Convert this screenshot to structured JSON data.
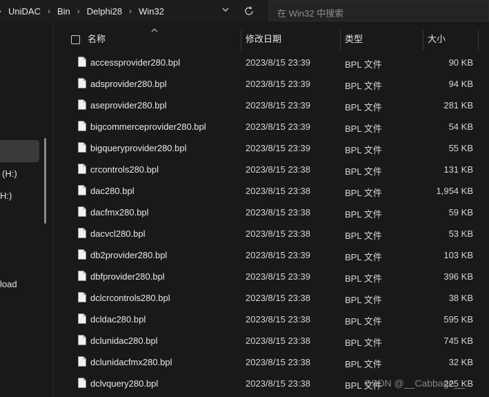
{
  "address_bar": {
    "breadcrumbs": [
      "UniDAC",
      "Bin",
      "Delphi28",
      "Win32"
    ],
    "separator": "›",
    "dropdown_icon": "chevron-down-icon",
    "refresh_icon": "refresh-icon"
  },
  "search": {
    "placeholder": "在 Win32 中搜索"
  },
  "sidebar": {
    "fragments": [
      "(H:)",
      "H:)",
      "load"
    ]
  },
  "columns": {
    "name": "名称",
    "date": "修改日期",
    "type": "类型",
    "size": "大小"
  },
  "files": [
    {
      "name": "accessprovider280.bpl",
      "date": "2023/8/15 23:39",
      "type": "BPL 文件",
      "size": "90 KB"
    },
    {
      "name": "adsprovider280.bpl",
      "date": "2023/8/15 23:39",
      "type": "BPL 文件",
      "size": "94 KB"
    },
    {
      "name": "aseprovider280.bpl",
      "date": "2023/8/15 23:39",
      "type": "BPL 文件",
      "size": "281 KB"
    },
    {
      "name": "bigcommerceprovider280.bpl",
      "date": "2023/8/15 23:39",
      "type": "BPL 文件",
      "size": "54 KB"
    },
    {
      "name": "bigqueryprovider280.bpl",
      "date": "2023/8/15 23:39",
      "type": "BPL 文件",
      "size": "55 KB"
    },
    {
      "name": "crcontrols280.bpl",
      "date": "2023/8/15 23:38",
      "type": "BPL 文件",
      "size": "131 KB"
    },
    {
      "name": "dac280.bpl",
      "date": "2023/8/15 23:38",
      "type": "BPL 文件",
      "size": "1,954 KB"
    },
    {
      "name": "dacfmx280.bpl",
      "date": "2023/8/15 23:38",
      "type": "BPL 文件",
      "size": "59 KB"
    },
    {
      "name": "dacvcl280.bpl",
      "date": "2023/8/15 23:38",
      "type": "BPL 文件",
      "size": "53 KB"
    },
    {
      "name": "db2provider280.bpl",
      "date": "2023/8/15 23:39",
      "type": "BPL 文件",
      "size": "103 KB"
    },
    {
      "name": "dbfprovider280.bpl",
      "date": "2023/8/15 23:39",
      "type": "BPL 文件",
      "size": "396 KB"
    },
    {
      "name": "dclcrcontrols280.bpl",
      "date": "2023/8/15 23:38",
      "type": "BPL 文件",
      "size": "38 KB"
    },
    {
      "name": "dcldac280.bpl",
      "date": "2023/8/15 23:38",
      "type": "BPL 文件",
      "size": "595 KB"
    },
    {
      "name": "dclunidac280.bpl",
      "date": "2023/8/15 23:38",
      "type": "BPL 文件",
      "size": "745 KB"
    },
    {
      "name": "dclunidacfmx280.bpl",
      "date": "2023/8/15 23:38",
      "type": "BPL 文件",
      "size": "32 KB"
    },
    {
      "name": "dclvquery280.bpl",
      "date": "2023/8/15 23:38",
      "type": "BPL 文件",
      "size": "225 KB"
    }
  ],
  "watermark": "CSDN @__Cabbage__",
  "colors": {
    "background": "#191919",
    "text": "#e6e6e6",
    "selection": "#3a3a3a"
  }
}
